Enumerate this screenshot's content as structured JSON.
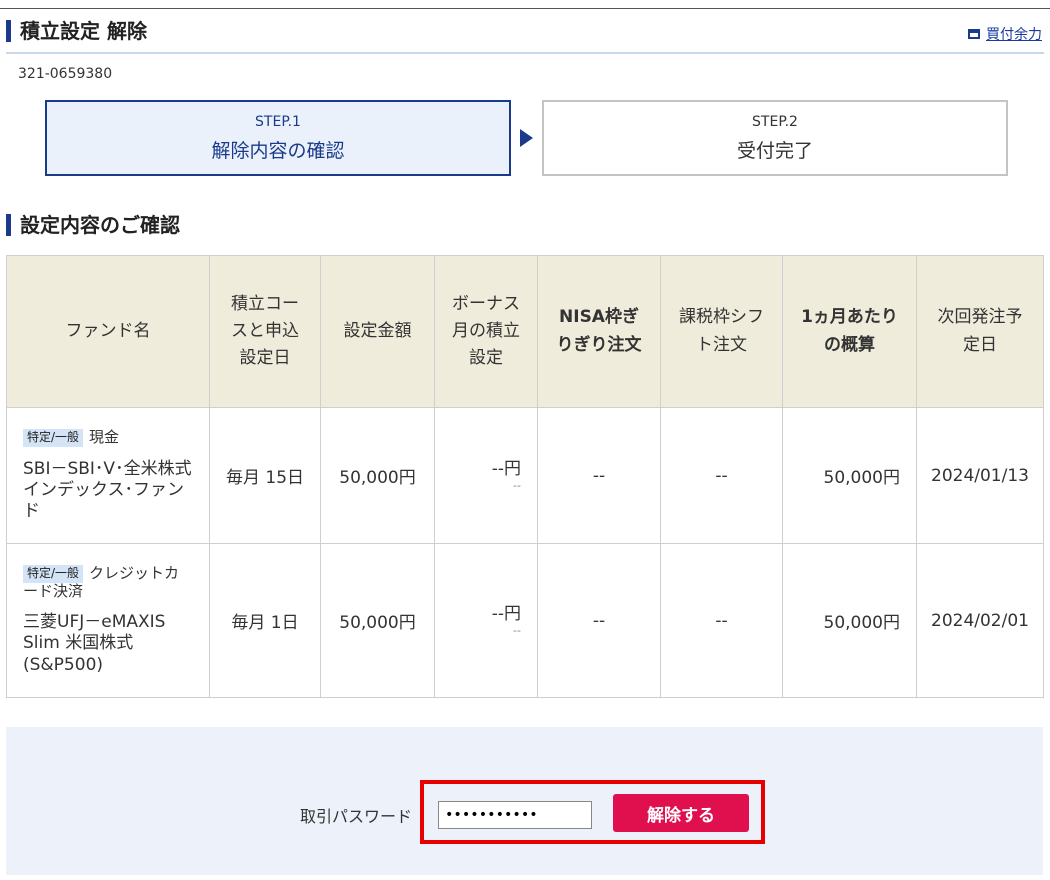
{
  "header": {
    "title": "積立設定 解除",
    "available_link": "買付余力",
    "account_number": "321-0659380"
  },
  "steps": [
    {
      "number": "STEP.1",
      "label": "解除内容の確認",
      "active": true
    },
    {
      "number": "STEP.2",
      "label": "受付完了",
      "active": false
    }
  ],
  "section": {
    "title": "設定内容のご確認"
  },
  "table": {
    "headers": [
      "ファンド名",
      "積立コースと申込設定日",
      "設定金額",
      "ボーナス月の積立設定",
      "NISA枠ぎりぎり注文",
      "課税枠シフト注文",
      "1ヵ月あたりの概算",
      "次回発注予定日"
    ],
    "rows": [
      {
        "badge": "特定/一般",
        "settlement": "現金",
        "fund": "SBI－SBI･V･全米株式インデックス･ファンド",
        "course": "毎月 15日",
        "amount": "50,000円",
        "bonus": "--円",
        "bonus_sub": "--",
        "nisa": "--",
        "shift": "--",
        "monthly": "50,000円",
        "next_date": "2024/01/13"
      },
      {
        "badge": "特定/一般",
        "settlement": "クレジットカード決済",
        "fund": "三菱UFJ－eMAXIS Slim 米国株式(S&P500)",
        "course": "毎月 1日",
        "amount": "50,000円",
        "bonus": "--円",
        "bonus_sub": "--",
        "nisa": "--",
        "shift": "--",
        "monthly": "50,000円",
        "next_date": "2024/02/01"
      }
    ]
  },
  "form": {
    "password_label": "取引パスワード",
    "password_value": "•••••••••••",
    "submit_label": "解除する"
  },
  "colors": {
    "accent": "#1a3a8c",
    "submit": "#e0104f",
    "highlight": "#e60000",
    "table_header_bg": "#efecdb",
    "form_bg": "#edf1f9"
  }
}
